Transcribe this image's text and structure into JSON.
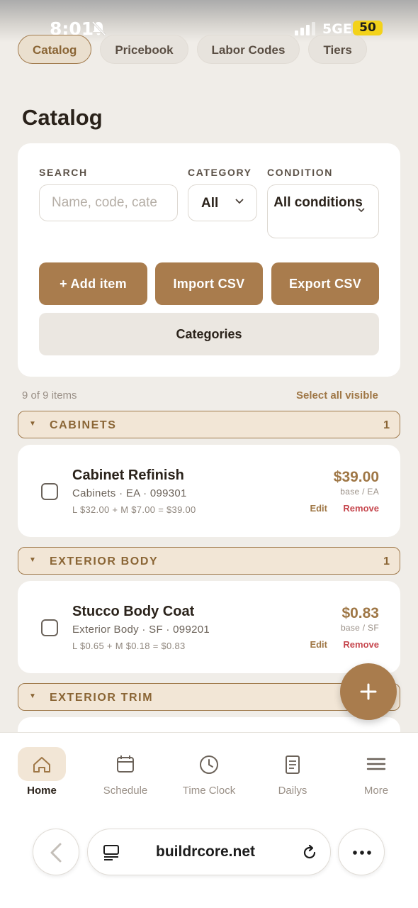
{
  "status_bar": {
    "time": "8:01",
    "network": "5GE",
    "battery": "50"
  },
  "tabs": [
    {
      "label": "Catalog",
      "active": true
    },
    {
      "label": "Pricebook",
      "active": false
    },
    {
      "label": "Labor Codes",
      "active": false
    },
    {
      "label": "Tiers",
      "active": false
    }
  ],
  "page_title": "Catalog",
  "filters": {
    "search_label": "SEARCH",
    "search_placeholder": "Name, code, cate",
    "category_label": "CATEGORY",
    "category_value": "All",
    "condition_label": "CONDITION",
    "condition_value": "All conditions"
  },
  "actions": {
    "add_item": "+ Add item",
    "import_csv": "Import CSV",
    "export_csv": "Export CSV",
    "categories": "Categories"
  },
  "list_summary": {
    "count_text": "9 of 9 items",
    "select_all": "Select all visible"
  },
  "groups": [
    {
      "name": "CABINETS",
      "count": "1",
      "item": {
        "name": "Cabinet Refinish",
        "meta": "Cabinets · EA · 099301",
        "formula": "L $32.00 + M $7.00 = $39.00",
        "price": "$39.00",
        "unit": "base / EA",
        "edit": "Edit",
        "remove": "Remove"
      }
    },
    {
      "name": "EXTERIOR BODY",
      "count": "1",
      "item": {
        "name": "Stucco Body Coat",
        "meta": "Exterior Body · SF · 099201",
        "formula": "L $0.65 + M $0.18 = $0.83",
        "price": "$0.83",
        "unit": "base / SF",
        "edit": "Edit",
        "remove": "Remove"
      }
    },
    {
      "name": "EXTERIOR TRIM",
      "count": ""
    }
  ],
  "bottom_nav": [
    {
      "label": "Home",
      "icon": "home-icon",
      "active": true
    },
    {
      "label": "Schedule",
      "icon": "calendar-icon",
      "active": false
    },
    {
      "label": "Time Clock",
      "icon": "clock-icon",
      "active": false
    },
    {
      "label": "Dailys",
      "icon": "document-icon",
      "active": false
    },
    {
      "label": "More",
      "icon": "menu-icon",
      "active": false
    }
  ],
  "browser": {
    "url": "buildrcore.net"
  },
  "colors": {
    "accent": "#a97c4d",
    "accent_text": "#9f7746",
    "danger": "#c6474e",
    "background": "#f0ede8",
    "group_bg": "#f2e6d6"
  }
}
